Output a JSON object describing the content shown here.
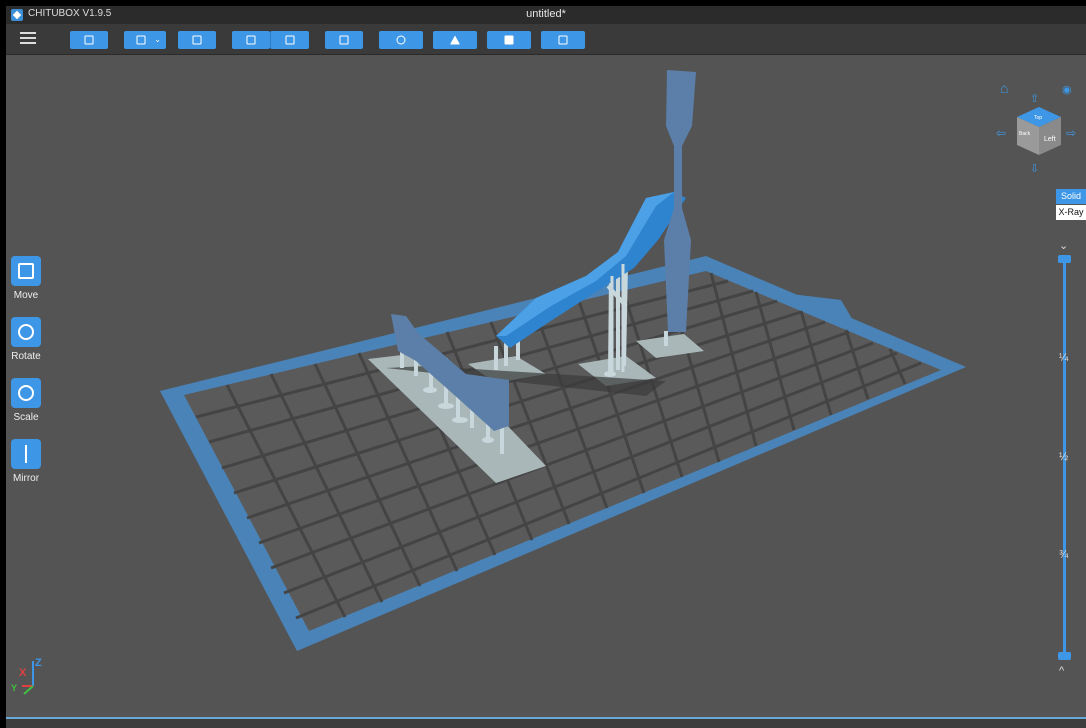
{
  "app": {
    "name": "CHITUBOX V1.9.5",
    "document_title": "untitled*"
  },
  "toolbar": {
    "buttons": [
      {
        "name": "open-file-button",
        "icon": "folder-icon"
      },
      {
        "name": "save-button",
        "icon": "save-icon"
      },
      {
        "name": "auto-layout-button",
        "icon": "layout-icon"
      },
      {
        "name": "import-button",
        "icon": "import-icon"
      },
      {
        "name": "export-button",
        "icon": "export-icon"
      },
      {
        "name": "settings-button",
        "icon": "settings-icon"
      },
      {
        "name": "supports-button",
        "icon": "supports-icon"
      },
      {
        "name": "hollow-button",
        "icon": "hollow-icon"
      },
      {
        "name": "slice-button",
        "icon": "slice-icon"
      },
      {
        "name": "machine-button",
        "icon": "machine-icon"
      }
    ]
  },
  "tools": [
    {
      "label": "Move",
      "icon": "move-icon"
    },
    {
      "label": "Rotate",
      "icon": "rotate-icon"
    },
    {
      "label": "Scale",
      "icon": "scale-icon"
    },
    {
      "label": "Mirror",
      "icon": "mirror-icon"
    }
  ],
  "view_modes": {
    "solid": "Solid",
    "xray": "X-Ray",
    "active": "Solid"
  },
  "view_cube": {
    "left_face": "Left",
    "top_face": "Top",
    "back_face": "Back"
  },
  "layer_slider": {
    "marks": [
      "¼",
      "½",
      "¾"
    ]
  },
  "axis": {
    "x": "X",
    "y": "Y",
    "z": "Z"
  },
  "colors": {
    "accent": "#3d97e6",
    "viewport_bg": "#545454",
    "model": "#4b8fd3",
    "support": "#c8d7dc"
  }
}
